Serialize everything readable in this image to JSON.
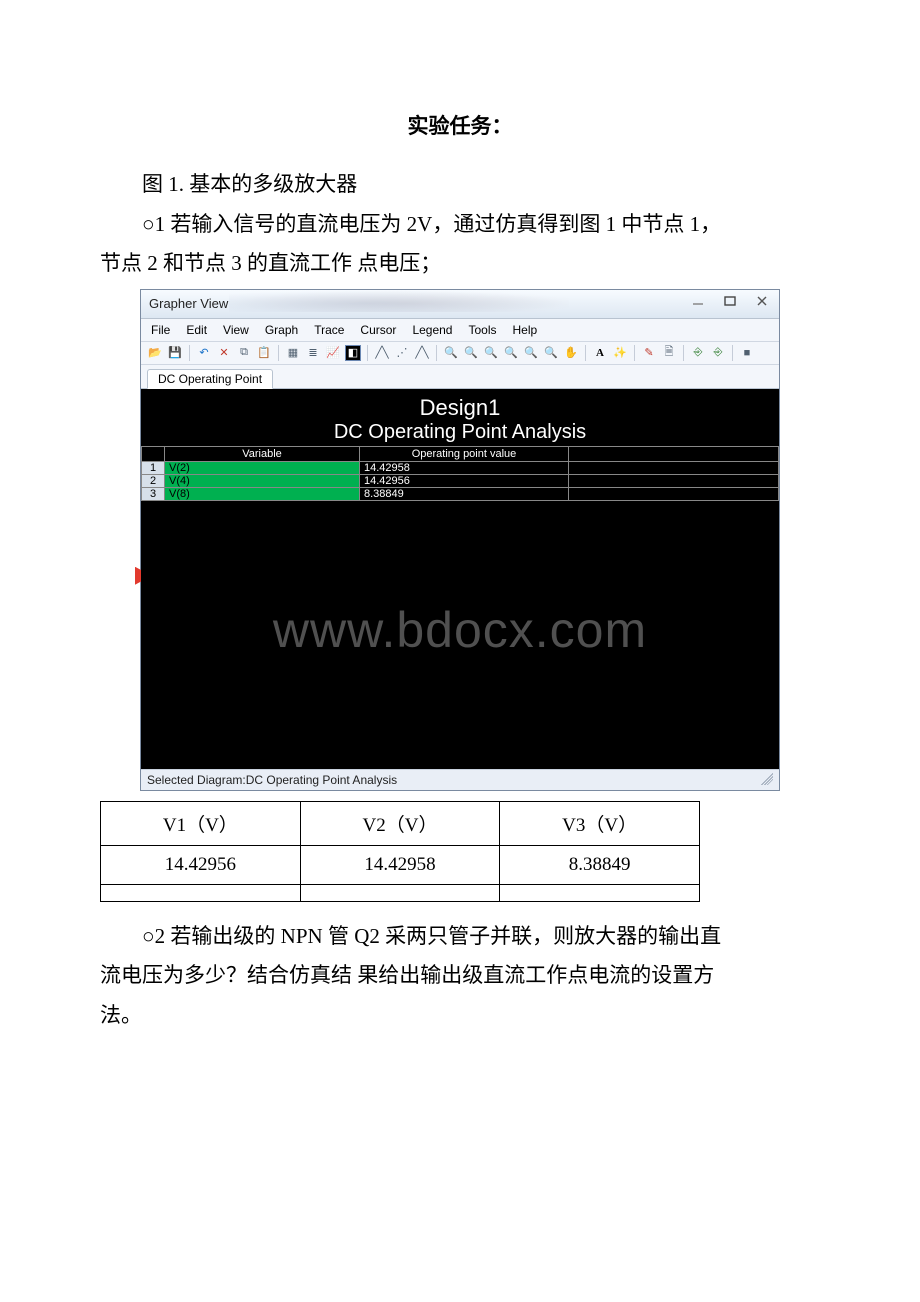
{
  "doc": {
    "title": "实验任务：",
    "fig1": "图 1. 基本的多级放大器",
    "q1_a": "○1  若输入信号的直流电压为 2V，通过仿真得到图 1 中节点 1，",
    "q1_b": "节点 2 和节点 3 的直流工作 点电压；",
    "q2_a": "○2  若输出级的 NPN 管 Q2 采两只管子并联，则放大器的输出直",
    "q2_b": "流电压为多少？结合仿真结 果给出输出级直流工作点电流的设置方",
    "q2_c": "法。"
  },
  "window": {
    "title": "Grapher View",
    "menu": [
      "File",
      "Edit",
      "View",
      "Graph",
      "Trace",
      "Cursor",
      "Legend",
      "Tools",
      "Help"
    ],
    "tab": "DC Operating Point",
    "status": "Selected Diagram:DC Operating Point Analysis",
    "watermark": "www.bdocx.com"
  },
  "chart_data": {
    "type": "table",
    "title": "Design1",
    "subtitle": "DC Operating Point Analysis",
    "columns": [
      "Variable",
      "Operating point value"
    ],
    "rows": [
      {
        "n": "1",
        "var": "V(2)",
        "val": "14.42958"
      },
      {
        "n": "2",
        "var": "V(4)",
        "val": "14.42956"
      },
      {
        "n": "3",
        "var": "V(8)",
        "val": "8.38849"
      }
    ]
  },
  "results": {
    "headers": [
      "V1（V）",
      "V2（V）",
      "V3（V）"
    ],
    "row1": [
      "14.42956",
      "14.42958",
      "8.38849"
    ],
    "row2": [
      "",
      "",
      ""
    ]
  },
  "icons": {
    "open": "open-icon",
    "save": "save-icon",
    "undo": "undo-icon",
    "delete": "delete-icon",
    "copy": "copy-icon",
    "paste": "paste-icon",
    "grid1": "grid-icon",
    "grid2": "grid-icon",
    "chart": "chart-icon",
    "inv": "invert-icon",
    "cur1": "cursor-icon",
    "cur2": "cursor-icon",
    "cur3": "cursor-icon",
    "z1": "zoom-icon",
    "z2": "zoom-icon",
    "z3": "zoom-icon",
    "z4": "zoom-icon",
    "z5": "zoom-icon",
    "z6": "zoom-icon",
    "hand": "hand-icon",
    "text": "text-icon",
    "wand": "wand-icon",
    "ruler": "ruler-icon",
    "doc": "doc-icon",
    "exp1": "export-icon",
    "exp2": "export-icon",
    "stop": "stop-icon"
  }
}
